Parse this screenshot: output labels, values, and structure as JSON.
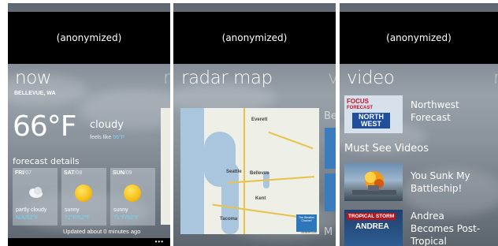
{
  "screens": [
    {
      "carrier_bar": "(anonymized)",
      "pivot_title": "now",
      "pivot_next": "r",
      "location": "BELLEVUE, WA",
      "temperature": "66°F",
      "condition": "cloudy",
      "feels_like_label": "feels like",
      "feels_like_value": "66°F",
      "forecast_heading": "forecast details",
      "days": [
        {
          "day": "FRI",
          "date": "/07",
          "condition": "partly cloudy",
          "temps": "N/A/52°F",
          "icon": "partly-cloudy-icon"
        },
        {
          "day": "SAT",
          "date": "/08",
          "condition": "sunny",
          "temps": "72°F/52°F",
          "icon": "sun-icon"
        },
        {
          "day": "SUN",
          "date": "/09",
          "condition": "sunny",
          "temps": "71°F/50°F",
          "icon": "sun-icon"
        }
      ],
      "updated": "Updated about 0 minutes ago",
      "more": "•••"
    },
    {
      "carrier_bar": "(anonymized)",
      "pivot_title": "radar map",
      "pivot_next": "v",
      "peek_label": "Be",
      "peek_label_2": "M",
      "map_labels": [
        "Seattle",
        "Bellevue",
        "Kent",
        "Tacoma",
        "Everett"
      ],
      "map_logo": "The Weather Channel",
      "map_credit": "weather.com"
    },
    {
      "carrier_bar": "(anonymized)",
      "pivot_title": "video",
      "pivot_next": "r",
      "videos": [
        {
          "title_line1": "Northwest",
          "title_line2": "Forecast",
          "thumb_top": "FOCUS",
          "thumb_mid": "FORECAST",
          "thumb_bottom": "NORTH WEST"
        },
        {
          "title_line1": "You Sunk My",
          "title_line2": "Battleship!"
        },
        {
          "title_line1": "Andrea",
          "title_line2": "Becomes Post-",
          "title_line3": "Tropical",
          "thumb_top": "TROPICAL STORM",
          "thumb_mid": "ANDREA"
        }
      ],
      "section_heading": "Must See Videos"
    }
  ],
  "colors": {
    "accent_blue": "#6fd2ff",
    "bar": "#000000",
    "sun": "#f7c21a"
  }
}
